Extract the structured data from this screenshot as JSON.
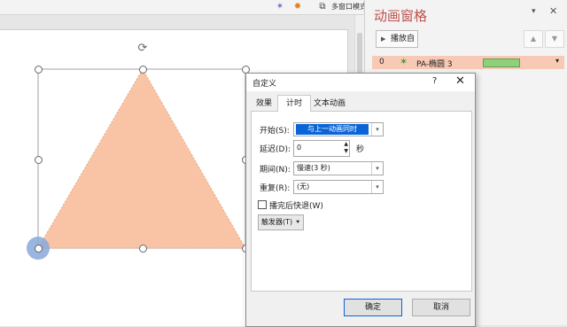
{
  "toolbar": {
    "multiwindow_label": "多窗口模式",
    "icons": [
      "star-effect-icon",
      "gear-icon",
      "window-icon"
    ]
  },
  "slide": {
    "shape_fill": "#f8c4a5",
    "motion_origin_color": "#8aa8dc",
    "rotate_icon": "rotate-icon"
  },
  "pane": {
    "title": "动画窗格",
    "play_button": "播放自",
    "item_index": "0",
    "item_label": "PA-椭圆 3",
    "item_bar_color": "#8fd07a",
    "row_highlight": "#f8c9b4"
  },
  "dialog": {
    "title": "自定义",
    "help": "?",
    "tabs": [
      "效果",
      "计时",
      "文本动画"
    ],
    "active_tab": "计时",
    "fields": {
      "start_label": "开始(S):",
      "start_value": "与上一动画同时",
      "delay_label": "延迟(D):",
      "delay_value": "0",
      "delay_unit": "秒",
      "period_label": "期间(N):",
      "period_value": "慢速(3 秒)",
      "repeat_label": "重复(R):",
      "repeat_value": "(无)",
      "rewind_label": "播完后快退(W)",
      "trigger_label": "触发器(T)"
    },
    "ok": "确定",
    "cancel": "取消"
  }
}
